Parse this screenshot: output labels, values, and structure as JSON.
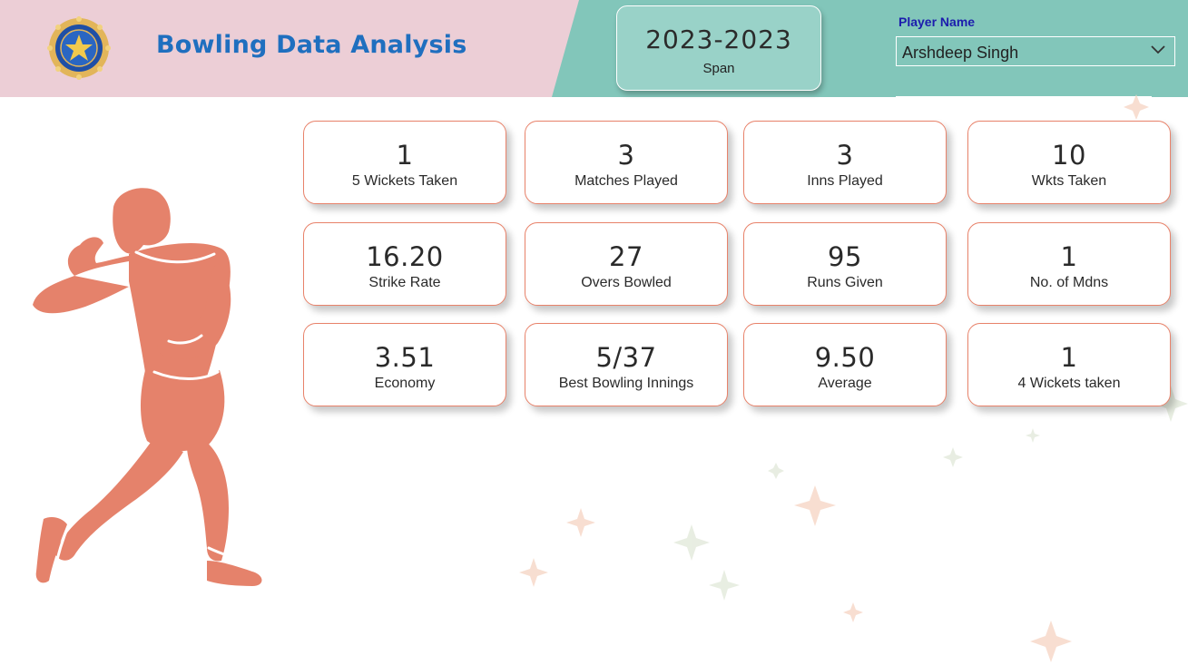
{
  "header": {
    "title": "Bowling Data Analysis",
    "logo_icon": "bcci-crest-icon"
  },
  "span_card": {
    "value": "2023-2023",
    "label": "Span"
  },
  "player_filter": {
    "label": "Player Name",
    "value": "Arshdeep Singh"
  },
  "kpis": [
    {
      "value": "1",
      "label": "5 Wickets Taken"
    },
    {
      "value": "3",
      "label": "Matches Played"
    },
    {
      "value": "3",
      "label": "Inns Played"
    },
    {
      "value": "10",
      "label": "Wkts Taken"
    },
    {
      "value": "16.20",
      "label": "Strike Rate"
    },
    {
      "value": "27",
      "label": "Overs Bowled"
    },
    {
      "value": "95",
      "label": "Runs Given"
    },
    {
      "value": "1",
      "label": "No. of Mdns"
    },
    {
      "value": "3.51",
      "label": "Economy"
    },
    {
      "value": "5/37",
      "label": "Best Bowling Innings"
    },
    {
      "value": "9.50",
      "label": "Average"
    },
    {
      "value": "1",
      "label": "4 Wickets taken"
    }
  ],
  "colors": {
    "header_left": "#ecced6",
    "header_right": "#82c6ba",
    "title": "#1f6fbf",
    "card_border": "#e8826a",
    "figure": "#e5826b"
  }
}
